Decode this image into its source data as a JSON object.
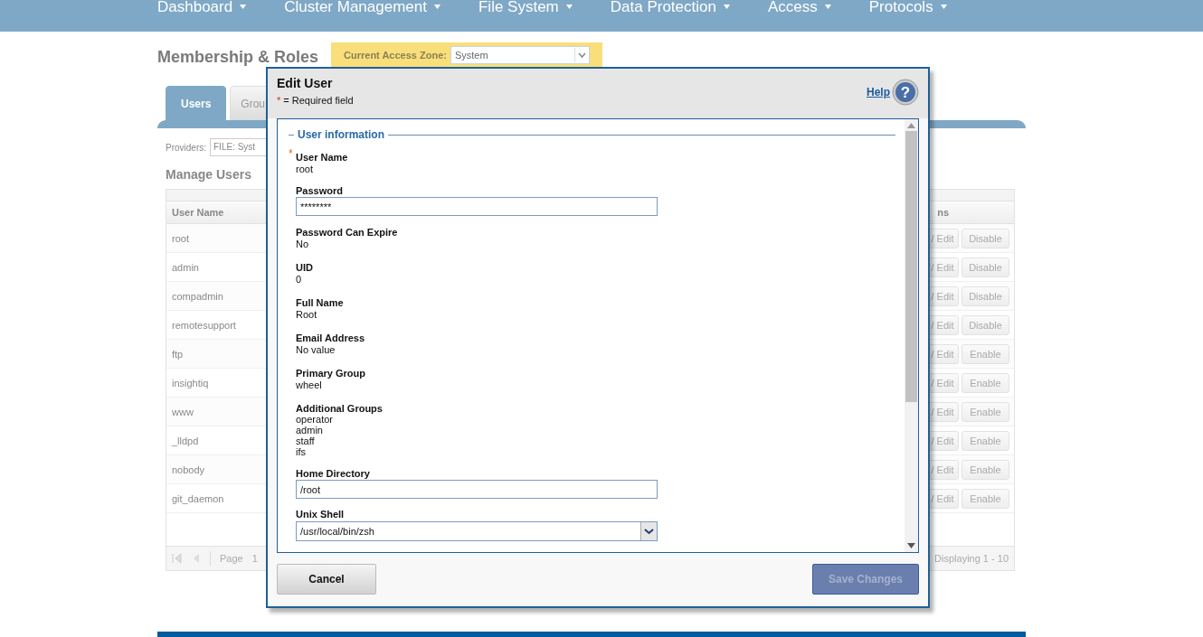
{
  "nav": [
    "Dashboard",
    "Cluster Management",
    "File System",
    "Data Protection",
    "Access",
    "Protocols"
  ],
  "page_title": "Membership & Roles",
  "access_zone": {
    "label": "Current Access Zone:",
    "value": "System"
  },
  "tabs": [
    {
      "label": "Users",
      "selected": true
    },
    {
      "label": "Grou",
      "selected": false
    }
  ],
  "providers": {
    "label": "Providers:",
    "value": "FILE: Syst"
  },
  "section_title": "Manage Users",
  "table": {
    "columns": [
      "User Name",
      "ns"
    ],
    "rows": [
      {
        "name": "root",
        "edit": "/ Edit",
        "toggle": "Disable"
      },
      {
        "name": "admin",
        "edit": "/ Edit",
        "toggle": "Disable"
      },
      {
        "name": "compadmin",
        "edit": "/ Edit",
        "toggle": "Disable"
      },
      {
        "name": "remotesupport",
        "edit": "/ Edit",
        "toggle": "Disable"
      },
      {
        "name": "ftp",
        "edit": "/ Edit",
        "toggle": "Enable"
      },
      {
        "name": "insightiq",
        "edit": "/ Edit",
        "toggle": "Enable"
      },
      {
        "name": "www",
        "edit": "/ Edit",
        "toggle": "Enable"
      },
      {
        "name": "_lldpd",
        "edit": "/ Edit",
        "toggle": "Enable"
      },
      {
        "name": "nobody",
        "edit": "/ Edit",
        "toggle": "Enable"
      },
      {
        "name": "git_daemon",
        "edit": "/ Edit",
        "toggle": "Enable"
      }
    ],
    "pager": {
      "page_label": "Page",
      "page": "1",
      "displaying": "Displaying 1 - 10"
    }
  },
  "dialog": {
    "title": "Edit User",
    "required_mark": "*",
    "required_note": "= Required field",
    "help": "Help",
    "help_icon": "?",
    "legend": "User information",
    "fields": [
      {
        "kind": "text",
        "label": "User Name",
        "required": true,
        "value": "root"
      },
      {
        "kind": "input",
        "label": "Password",
        "required": false,
        "value": "********"
      },
      {
        "kind": "text",
        "label": "Password Can Expire",
        "required": false,
        "value": "No"
      },
      {
        "kind": "text",
        "label": "UID",
        "required": false,
        "value": "0"
      },
      {
        "kind": "text",
        "label": "Full Name",
        "required": false,
        "value": "Root"
      },
      {
        "kind": "text",
        "label": "Email Address",
        "required": false,
        "value": "No value"
      },
      {
        "kind": "text",
        "label": "Primary Group",
        "required": false,
        "value": "wheel"
      },
      {
        "kind": "list",
        "label": "Additional Groups",
        "required": false,
        "values": [
          "operator",
          "admin",
          "staff",
          "ifs"
        ]
      },
      {
        "kind": "input",
        "label": "Home Directory",
        "required": false,
        "value": "/root"
      },
      {
        "kind": "select",
        "label": "Unix Shell",
        "required": false,
        "value": "/usr/local/bin/zsh"
      }
    ],
    "cancel": "Cancel",
    "save": {
      "label": "Save Changes",
      "disabled": true
    }
  }
}
